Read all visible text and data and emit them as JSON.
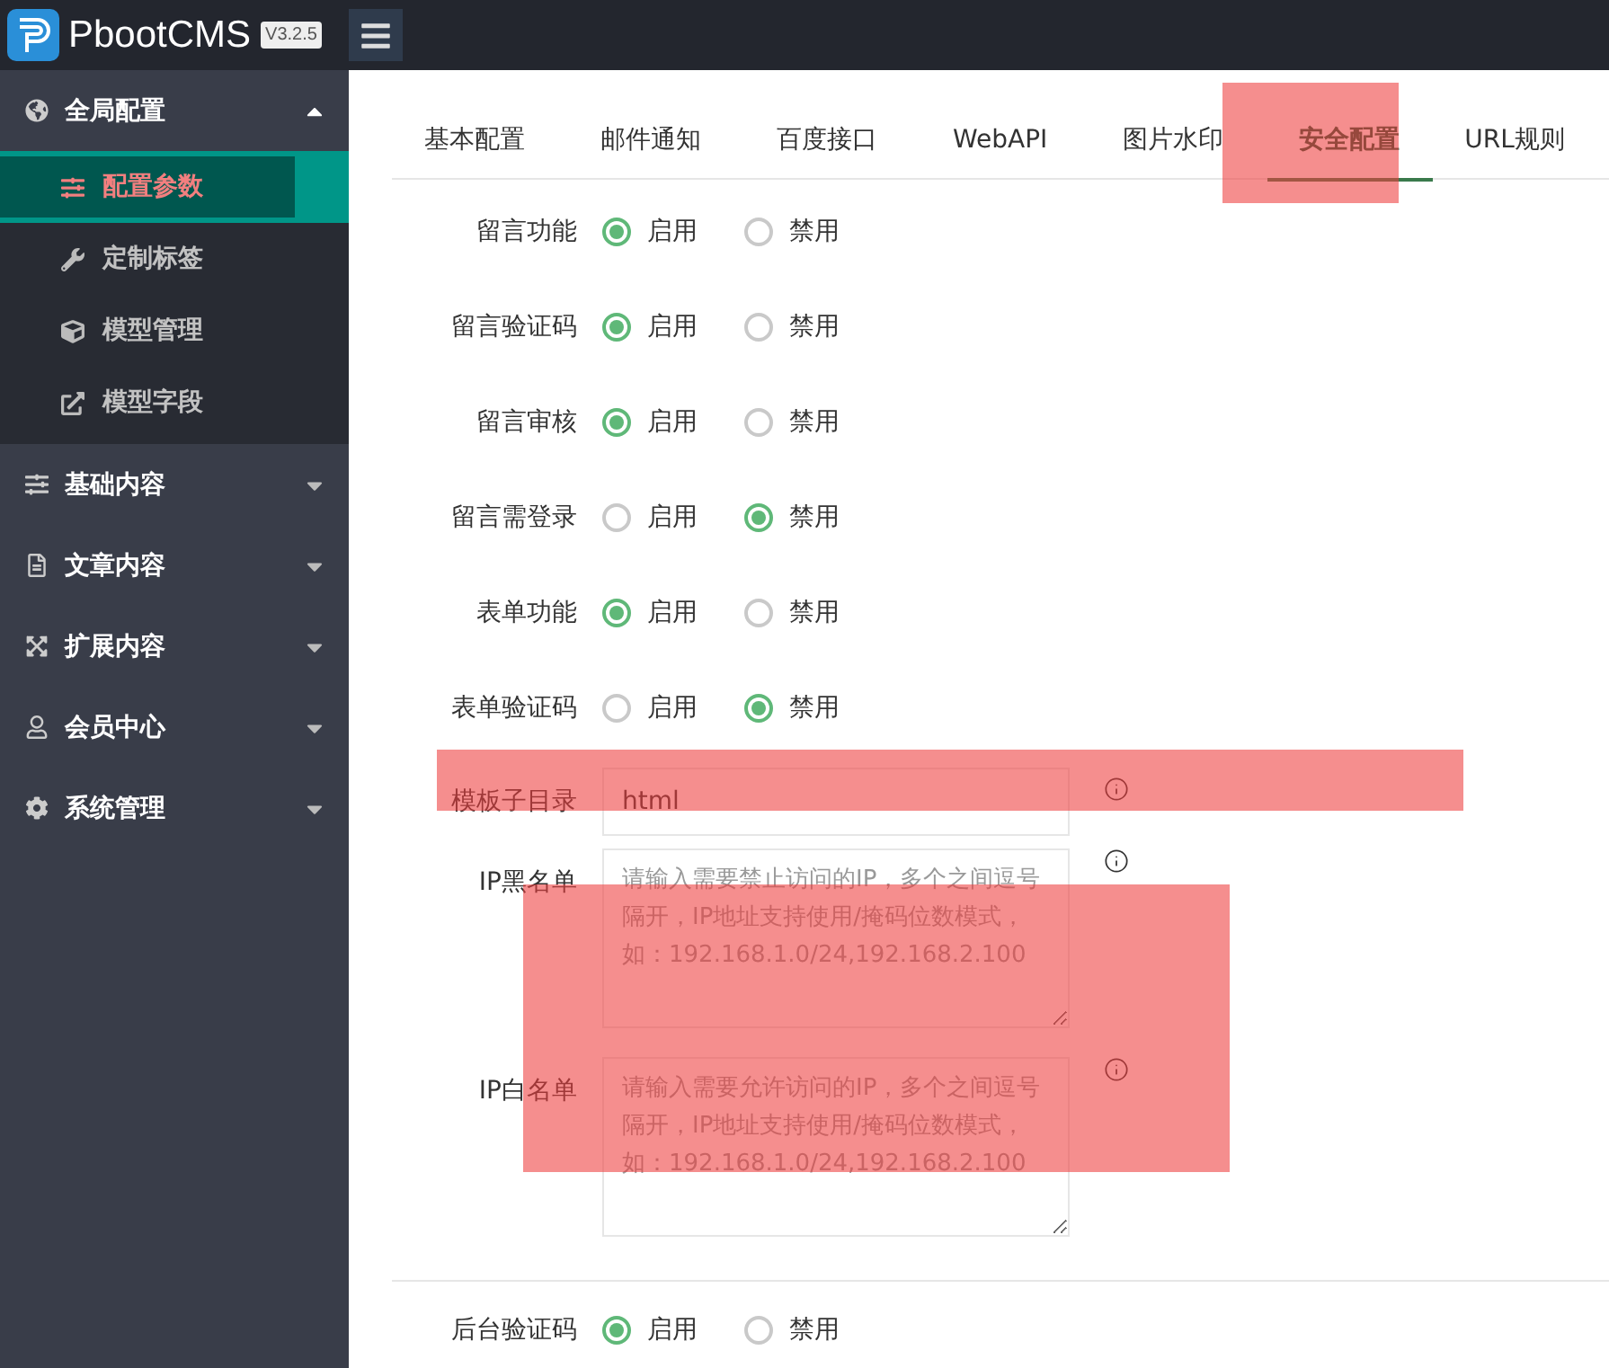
{
  "header": {
    "logo_text": "PbootCMS",
    "version": "V3.2.5"
  },
  "sidebar": {
    "groups": [
      {
        "label": "全局配置",
        "expanded": true,
        "children": [
          {
            "label": "配置参数",
            "selected": true
          },
          {
            "label": "定制标签",
            "selected": false
          },
          {
            "label": "模型管理",
            "selected": false
          },
          {
            "label": "模型字段",
            "selected": false
          }
        ]
      },
      {
        "label": "基础内容",
        "expanded": false
      },
      {
        "label": "文章内容",
        "expanded": false
      },
      {
        "label": "扩展内容",
        "expanded": false
      },
      {
        "label": "会员中心",
        "expanded": false
      },
      {
        "label": "系统管理",
        "expanded": false
      }
    ]
  },
  "tabs": [
    {
      "label": "基本配置",
      "selected": false
    },
    {
      "label": "邮件通知",
      "selected": false
    },
    {
      "label": "百度接口",
      "selected": false
    },
    {
      "label": "WebAPI",
      "selected": false
    },
    {
      "label": "图片水印",
      "selected": false
    },
    {
      "label": "安全配置",
      "selected": true
    },
    {
      "label": "URL规则",
      "selected": false
    }
  ],
  "form": {
    "rows": [
      {
        "kind": "radio",
        "label": "留言功能",
        "options": [
          {
            "label": "启用",
            "selected": true
          },
          {
            "label": "禁用",
            "selected": false
          }
        ]
      },
      {
        "kind": "radio",
        "label": "留言验证码",
        "options": [
          {
            "label": "启用",
            "selected": true
          },
          {
            "label": "禁用",
            "selected": false
          }
        ]
      },
      {
        "kind": "radio",
        "label": "留言审核",
        "options": [
          {
            "label": "启用",
            "selected": true
          },
          {
            "label": "禁用",
            "selected": false
          }
        ]
      },
      {
        "kind": "radio",
        "label": "留言需登录",
        "options": [
          {
            "label": "启用",
            "selected": false
          },
          {
            "label": "禁用",
            "selected": true
          }
        ]
      },
      {
        "kind": "radio",
        "label": "表单功能",
        "options": [
          {
            "label": "启用",
            "selected": true
          },
          {
            "label": "禁用",
            "selected": false
          }
        ]
      },
      {
        "kind": "radio",
        "label": "表单验证码",
        "options": [
          {
            "label": "启用",
            "selected": false
          },
          {
            "label": "禁用",
            "selected": true
          }
        ]
      },
      {
        "kind": "text",
        "label": "模板子目录",
        "value": "html"
      },
      {
        "kind": "textarea",
        "label": "IP黑名单",
        "placeholder": "请输入需要禁止访问的IP，多个之间逗号隔开，IP地址支持使用/掩码位数模式，如：192.168.1.0/24,192.168.2.100"
      },
      {
        "kind": "textarea",
        "label": "IP白名单",
        "placeholder": "请输入需要允许访问的IP，多个之间逗号隔开，IP地址支持使用/掩码位数模式，如：192.168.1.0/24,192.168.2.100"
      },
      {
        "kind": "divider"
      },
      {
        "kind": "radio",
        "label": "后台验证码",
        "options": [
          {
            "label": "启用",
            "selected": true
          },
          {
            "label": "禁用",
            "selected": false
          }
        ]
      }
    ]
  }
}
